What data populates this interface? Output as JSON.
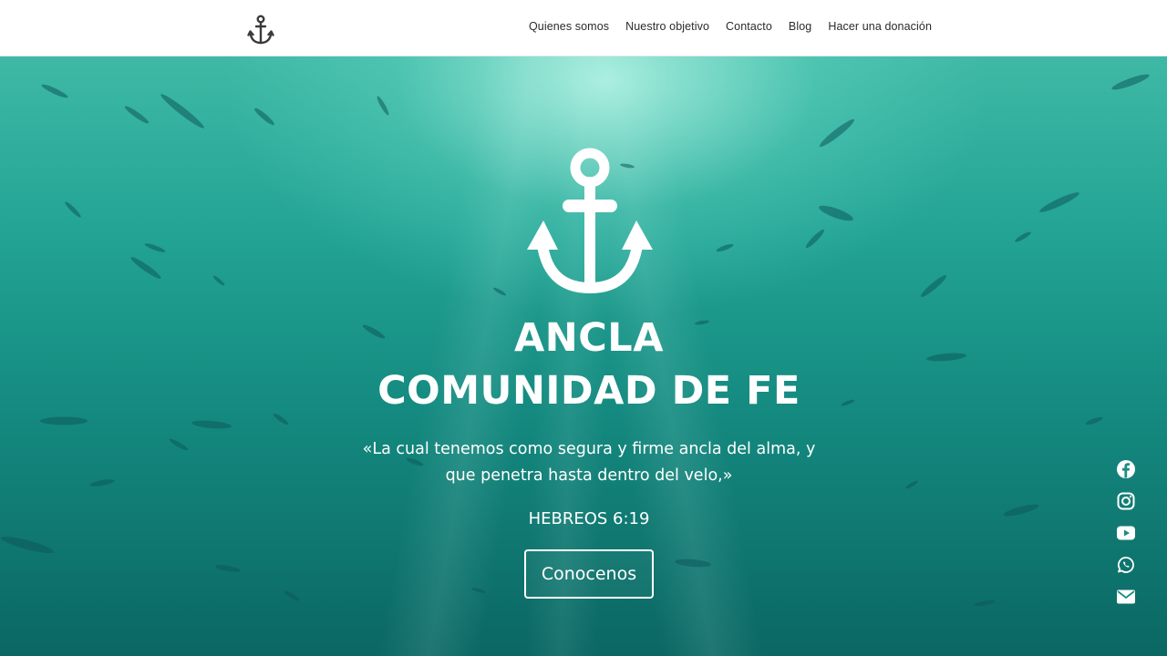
{
  "header": {
    "logo_icon": "anchor-icon",
    "nav": [
      {
        "label": "Quienes somos"
      },
      {
        "label": "Nuestro objetivo"
      },
      {
        "label": "Contacto"
      },
      {
        "label": "Blog"
      },
      {
        "label": "Hacer una donación"
      }
    ]
  },
  "hero": {
    "icon": "anchor-icon",
    "title_line1": "ANCLA",
    "title_line2": "COMUNIDAD DE FE",
    "quote_line1": "«La cual tenemos como segura y firme ancla del alma, y",
    "quote_line2": "que penetra hasta dentro del velo,»",
    "reference": "HEBREOS 6:19",
    "cta_label": "Conocenos"
  },
  "social": [
    "facebook-icon",
    "instagram-icon",
    "youtube-icon",
    "whatsapp-icon",
    "email-icon"
  ],
  "colors": {
    "header_bg": "#ffffff",
    "nav_text": "#2b2b2b",
    "hero_top": "#3fb9a6",
    "hero_bottom": "#0b6763",
    "hero_text": "#ffffff"
  }
}
